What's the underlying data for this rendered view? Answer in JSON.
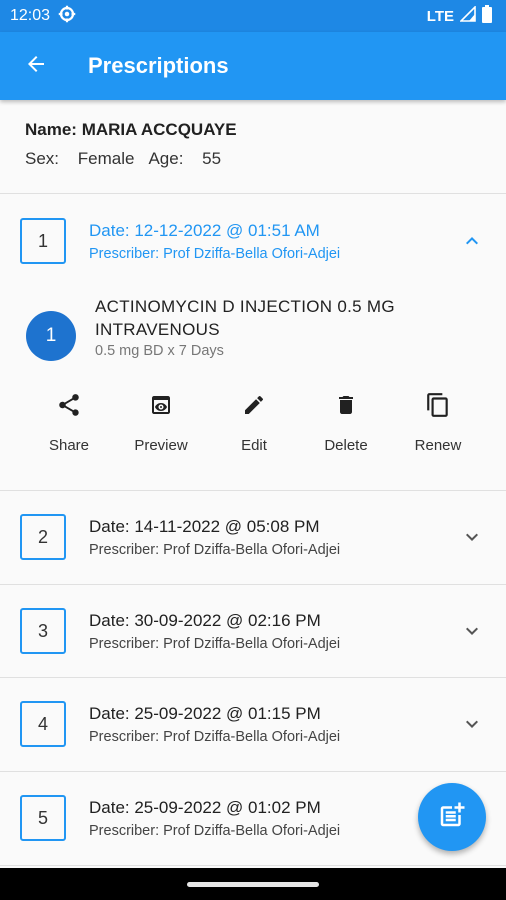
{
  "status_bar": {
    "time": "12:03",
    "network": "LTE"
  },
  "app_bar": {
    "title": "Prescriptions",
    "back_icon": "arrow-back-icon"
  },
  "patient": {
    "name_label": "Name:",
    "name": "MARIA ACCQUAYE",
    "sex_label": "Sex:",
    "sex": "Female",
    "age_label": "Age:",
    "age": "55"
  },
  "prescriptions": [
    {
      "number": "1",
      "date": "Date: 12-12-2022 @ 01:51 AM",
      "prescriber": "Prescriber: Prof Dziffa-Bella Ofori-Adjei",
      "expanded": true,
      "drugs": [
        {
          "number": "1",
          "name": "ACTINOMYCIN D INJECTION 0.5 MG INTRAVENOUS",
          "dose": "0.5 mg BD x 7 Days"
        }
      ]
    },
    {
      "number": "2",
      "date": "Date: 14-11-2022 @ 05:08 PM",
      "prescriber": "Prescriber: Prof Dziffa-Bella Ofori-Adjei",
      "expanded": false
    },
    {
      "number": "3",
      "date": "Date: 30-09-2022 @ 02:16 PM",
      "prescriber": "Prescriber: Prof Dziffa-Bella Ofori-Adjei",
      "expanded": false
    },
    {
      "number": "4",
      "date": "Date: 25-09-2022 @ 01:15 PM",
      "prescriber": "Prescriber: Prof Dziffa-Bella Ofori-Adjei",
      "expanded": false
    },
    {
      "number": "5",
      "date": "Date: 25-09-2022 @ 01:02 PM",
      "prescriber": "Prescriber: Prof Dziffa-Bella Ofori-Adjei",
      "expanded": false
    }
  ],
  "actions": [
    {
      "label": "Share",
      "icon": "share-icon"
    },
    {
      "label": "Preview",
      "icon": "preview-icon"
    },
    {
      "label": "Edit",
      "icon": "edit-icon"
    },
    {
      "label": "Delete",
      "icon": "delete-icon"
    },
    {
      "label": "Renew",
      "icon": "copy-icon"
    }
  ],
  "fab": {
    "icon": "add-note-icon"
  },
  "colors": {
    "primary": "#2196f3",
    "status_bar": "#1e88e5",
    "drug_circle": "#1e73cf"
  }
}
